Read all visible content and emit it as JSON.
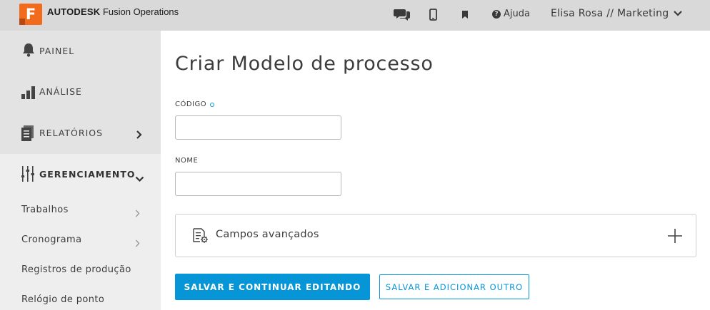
{
  "header": {
    "logo_letter": "F",
    "brand_bold": "AUTODESK",
    "brand_product": "Fusion Operations",
    "icons": [
      "chat-icon",
      "mobile-icon",
      "bookmark-icon",
      "help-icon"
    ],
    "help_label": "Ajuda",
    "user_label": "Elisa Rosa // Marketing"
  },
  "sidebar": {
    "items": [
      {
        "label": "PAINEL",
        "icon": "bell-icon"
      },
      {
        "label": "ANÁLISE",
        "icon": "bar-chart-icon"
      },
      {
        "label": "RELATÓRIOS",
        "icon": "reports-icon"
      },
      {
        "label": "GERENCIAMENTO",
        "icon": "sliders-icon"
      }
    ],
    "subitems": [
      {
        "label": "Trabalhos"
      },
      {
        "label": "Cronograma"
      },
      {
        "label": "Registros de produção"
      },
      {
        "label": "Relógio de ponto"
      }
    ]
  },
  "form": {
    "title": "Criar Modelo de processo",
    "codigo_label": "CÓDIGO",
    "codigo_value": "",
    "nome_label": "NOME",
    "nome_value": "",
    "advanced_label": "Campos avançados",
    "save_continue_label": "SALVAR E CONTINUAR EDITANDO",
    "save_add_label": "SALVAR E ADICIONAR OUTRO"
  },
  "colors": {
    "accent": "#0696d7",
    "brand_orange": "#f26a1b",
    "topbar": "#d9d9d9",
    "sidebar": "#eeeeee"
  }
}
